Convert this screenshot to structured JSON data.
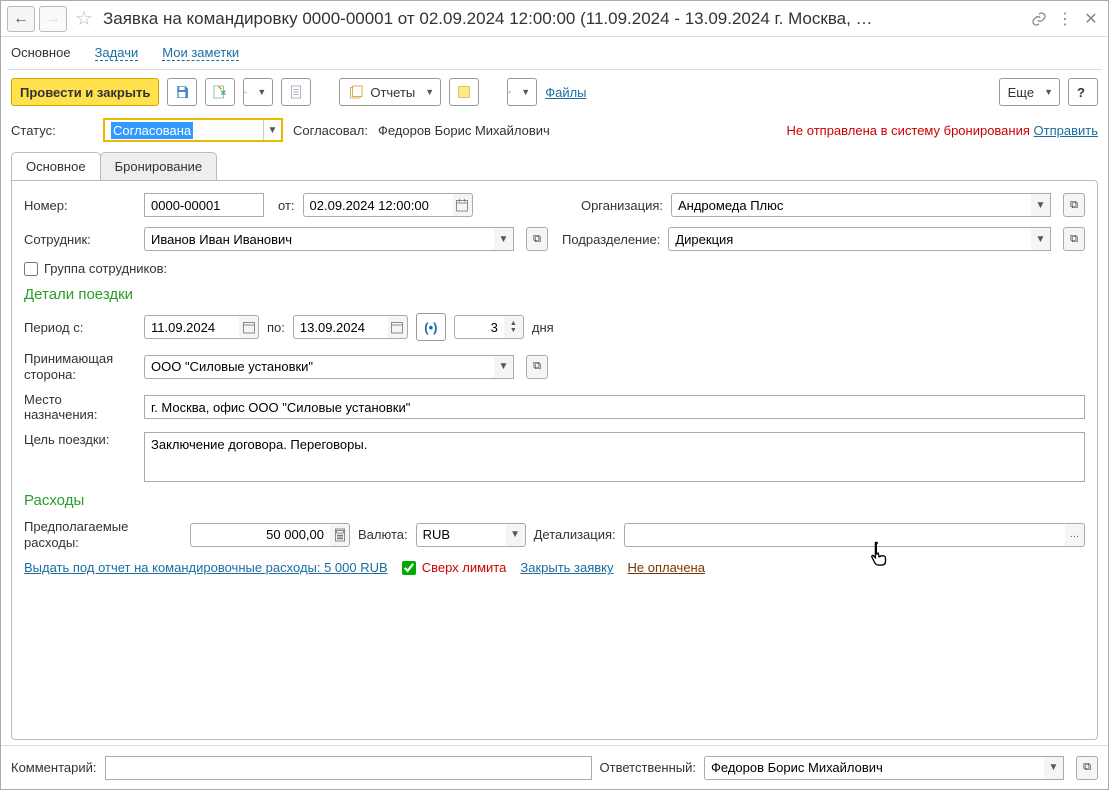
{
  "titlebar": {
    "title": "Заявка на командировку 0000-00001  от 02.09.2024 12:00:00 (11.09.2024 - 13.09.2024 г. Москва, …"
  },
  "nav": {
    "main": "Основное",
    "tasks": "Задачи",
    "notes": "Мои заметки"
  },
  "toolbar": {
    "post_close": "Провести и закрыть",
    "reports": "Отчеты",
    "files": "Файлы",
    "more": "Еще"
  },
  "status": {
    "label": "Статус:",
    "value": "Согласована",
    "approved_by_label": "Согласовал:",
    "approved_by": "Федоров Борис Михайлович",
    "warn": "Не отправлена в систему бронирования",
    "send": "Отправить"
  },
  "tabs": {
    "main": "Основное",
    "booking": "Бронирование"
  },
  "form": {
    "number_label": "Номер:",
    "number": "0000-00001",
    "from_label": "от:",
    "date": "02.09.2024 12:00:00",
    "org_label": "Организация:",
    "org": "Андромеда Плюс",
    "employee_label": "Сотрудник:",
    "employee": "Иванов Иван Иванович",
    "dept_label": "Подразделение:",
    "dept": "Дирекция",
    "group_label": "Группа сотрудников:",
    "trip_section": "Детали поездки",
    "period_from_label": "Период с:",
    "period_from": "11.09.2024",
    "period_to_label": "по:",
    "period_to": "13.09.2024",
    "days": "3",
    "days_label": "дня",
    "host_label": "Принимающая сторона:",
    "host": "ООО \"Силовые установки\"",
    "destination_label": "Место назначения:",
    "destination": "г. Москва, офис ООО \"Силовые установки\"",
    "purpose_label": "Цель поездки:",
    "purpose": "Заключение договора. Переговоры.",
    "expenses_section": "Расходы",
    "est_label": "Предполагаемые расходы:",
    "est": "50 000,00",
    "currency_label": "Валюта:",
    "currency": "RUB",
    "details_label": "Детализация:",
    "advance_link": "Выдать под отчет на командировочные расходы: 5 000 RUB",
    "over_limit": "Сверх лимита",
    "close_req": "Закрыть заявку",
    "not_paid": "Не оплачена"
  },
  "footer": {
    "comment_label": "Комментарий:",
    "responsible_label": "Ответственный:",
    "responsible": "Федоров Борис Михайлович"
  }
}
